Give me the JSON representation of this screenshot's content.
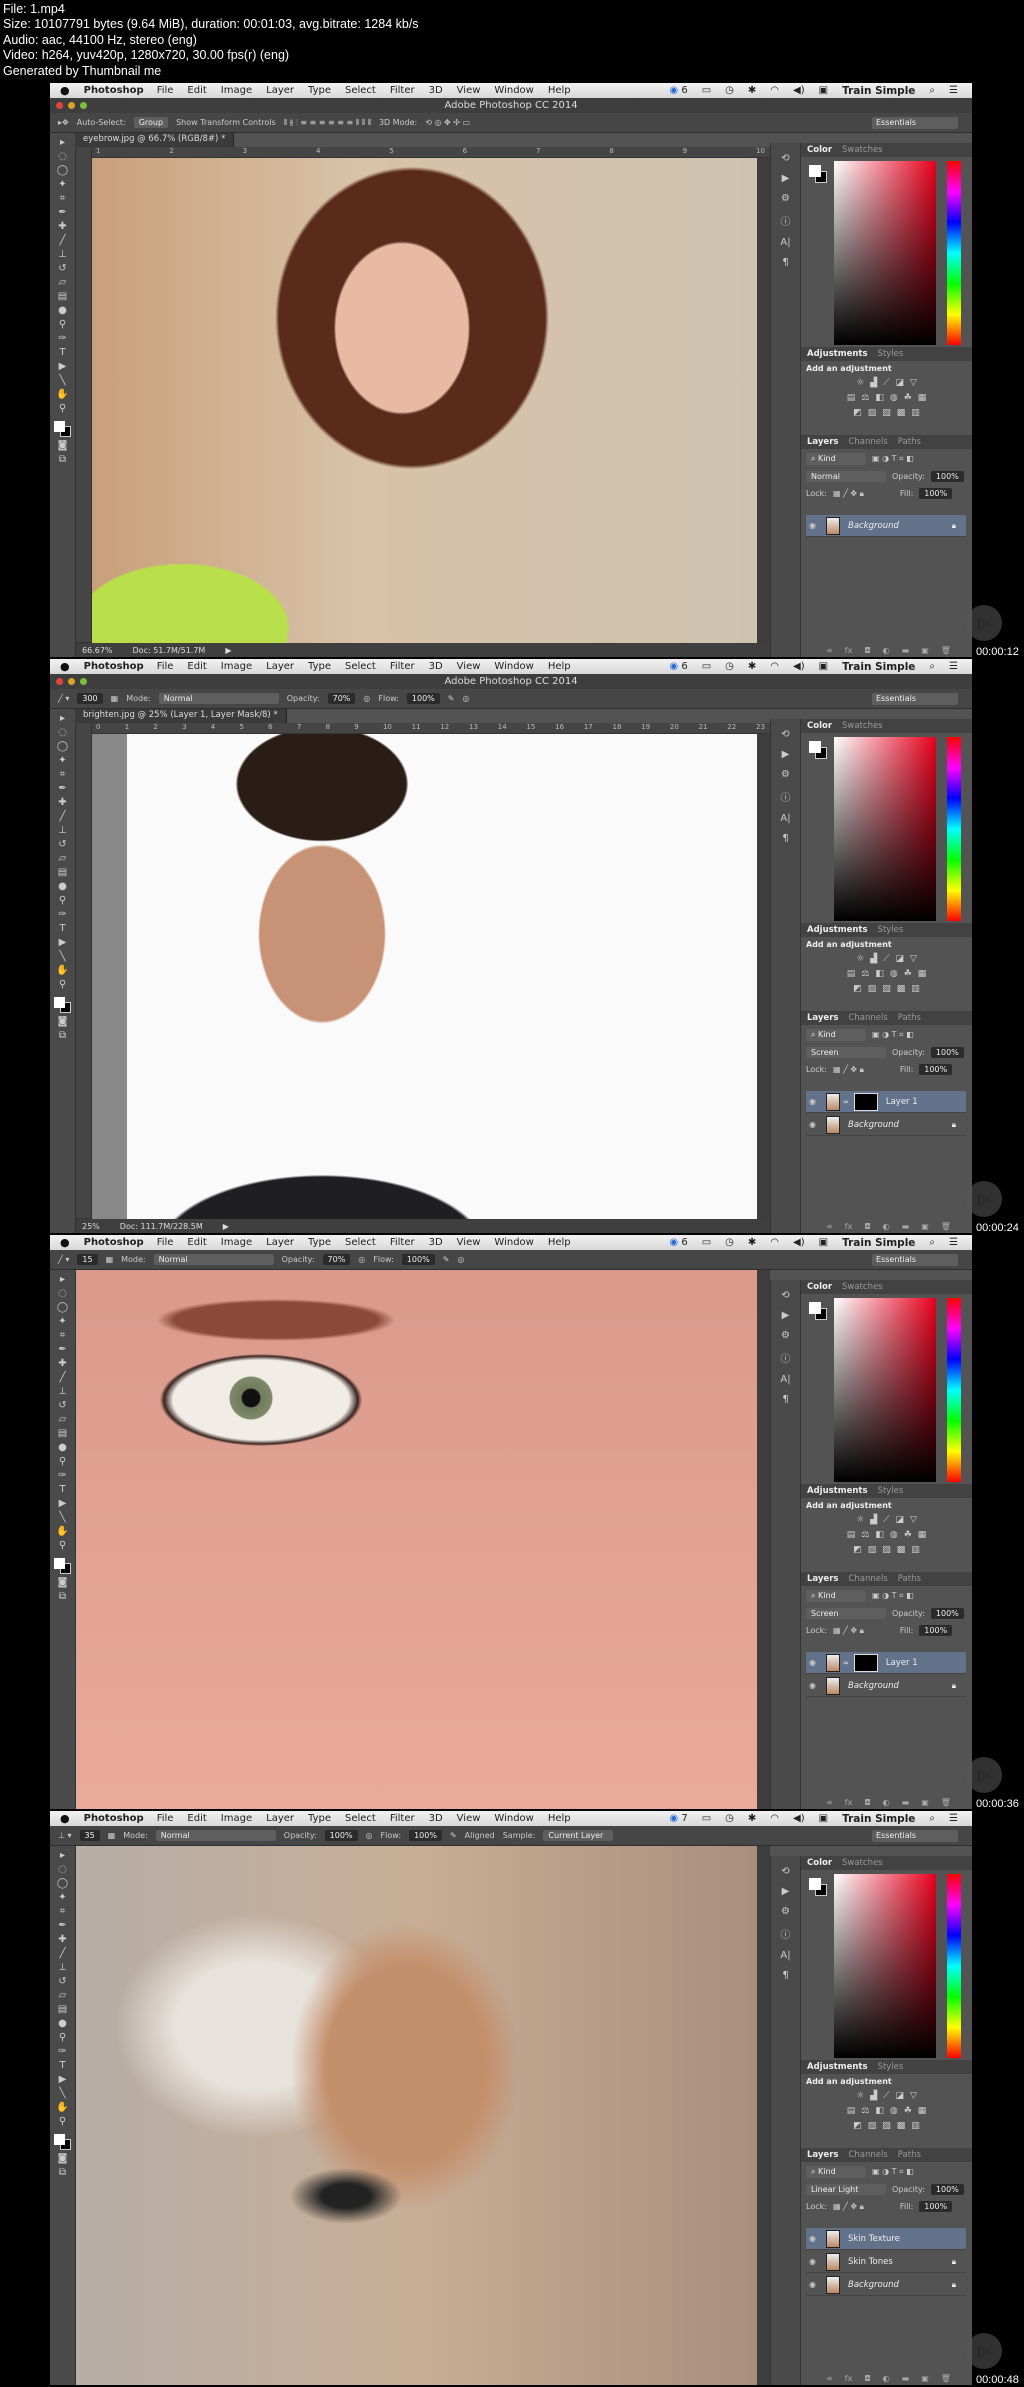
{
  "info_lines": [
    "File: 1.mp4",
    "Size: 10107791 bytes (9.64 MiB), duration: 00:01:03, avg.bitrate: 1284 kb/s",
    "Audio: aac, 44100 Hz, stereo (eng)",
    "Video: h264, yuv420p, 1280x720, 30.00 fps(r) (eng)",
    "Generated by Thumbnail me"
  ],
  "menubar": {
    "app": "Photoshop",
    "items": [
      "File",
      "Edit",
      "Image",
      "Layer",
      "Type",
      "Select",
      "Filter",
      "3D",
      "View",
      "Window",
      "Help"
    ],
    "user": "Train Simple"
  },
  "panels": {
    "color_tabs": [
      "Color",
      "Swatches"
    ],
    "adjust_tabs": [
      "Adjustments",
      "Styles"
    ],
    "add_adjustment": "Add an adjustment",
    "layer_tabs": [
      "Layers",
      "Channels",
      "Paths"
    ],
    "kind": "Kind",
    "opacity_label": "Opacity:",
    "lock_label": "Lock:",
    "fill_label": "Fill:"
  },
  "workspace": "Essentials",
  "frames": [
    {
      "cc_count": "6",
      "title": "Adobe Photoshop CC 2014",
      "tool": "move",
      "options": {
        "auto_select": "Auto-Select:",
        "auto_select_value": "Group",
        "transform": "Show Transform Controls",
        "mode3d": "3D Mode:"
      },
      "doc_tab": "eyebrow.jpg @ 66.7% (RGB/8#) *",
      "ruler": [
        "1",
        "2",
        "3",
        "4",
        "5",
        "6",
        "7",
        "8",
        "9",
        "10"
      ],
      "status": {
        "zoom": "66.67%",
        "doc": "Doc: 51.7M/51.7M"
      },
      "layers": {
        "blend": "Normal",
        "opacity": "100%",
        "fill": "100%",
        "items": [
          {
            "name": "Background",
            "locked": true,
            "selected": true
          }
        ]
      },
      "image": "woman-smiling",
      "timestamp": "00:00:12"
    },
    {
      "cc_count": "6",
      "title": "Adobe Photoshop CC 2014",
      "tool": "brush",
      "options": {
        "size": "300",
        "mode_label": "Mode:",
        "mode": "Normal",
        "opacity_label": "Opacity:",
        "opacity": "70%",
        "flow_label": "Flow:",
        "flow": "100%"
      },
      "doc_tab": "brighten.jpg @ 25% (Layer 1, Layer Mask/8) *",
      "ruler": [
        "0",
        "1",
        "2",
        "3",
        "4",
        "5",
        "6",
        "7",
        "8",
        "9",
        "10",
        "11",
        "12",
        "13",
        "14",
        "15",
        "16",
        "17",
        "18",
        "19",
        "20",
        "21",
        "22",
        "23"
      ],
      "status": {
        "zoom": "25%",
        "doc": "Doc: 111.7M/228.5M"
      },
      "layers": {
        "blend": "Screen",
        "opacity": "100%",
        "fill": "100%",
        "items": [
          {
            "name": "Layer 1",
            "mask": true,
            "selected": true
          },
          {
            "name": "Background",
            "locked": true
          }
        ]
      },
      "image": "man-portrait",
      "timestamp": "00:00:24"
    },
    {
      "cc_count": "6",
      "tool": "brush",
      "options": {
        "size": "15",
        "mode_label": "Mode:",
        "mode": "Normal",
        "opacity_label": "Opacity:",
        "opacity": "70%",
        "flow_label": "Flow:",
        "flow": "100%"
      },
      "layers": {
        "blend": "Screen",
        "opacity": "100%",
        "fill": "100%",
        "items": [
          {
            "name": "Layer 1",
            "mask": true,
            "selected": true
          },
          {
            "name": "Background",
            "locked": true
          }
        ]
      },
      "image": "eye-closeup",
      "timestamp": "00:00:36"
    },
    {
      "cc_count": "7",
      "tool": "clone-stamp",
      "options": {
        "size": "35",
        "mode_label": "Mode:",
        "mode": "Normal",
        "opacity_label": "Opacity:",
        "opacity": "100%",
        "flow_label": "Flow:",
        "flow": "100%",
        "aligned": "Aligned",
        "sample_label": "Sample:",
        "sample": "Current Layer"
      },
      "layers": {
        "blend": "Linear Light",
        "opacity": "100%",
        "fill": "100%",
        "items": [
          {
            "name": "Skin Texture",
            "selected": true
          },
          {
            "name": "Skin Tones",
            "locked": true
          },
          {
            "name": "Background",
            "locked": true
          }
        ]
      },
      "image": "face-blend",
      "timestamp": "00:00:48"
    }
  ],
  "colors": {
    "menubar": "#e6e6e6",
    "panel": "#535353",
    "selected_layer": "#62728a",
    "foreground": "#ffffff",
    "background": "#000000"
  }
}
